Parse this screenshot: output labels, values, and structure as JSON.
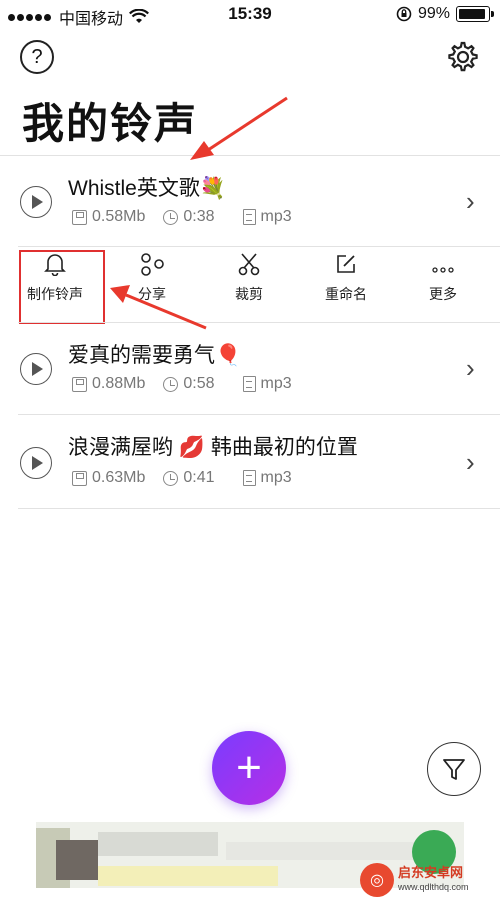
{
  "status_bar": {
    "carrier": "中国移动",
    "time": "15:39",
    "battery": "99%"
  },
  "page_title": "我的铃声",
  "songs": [
    {
      "title": "Whistle英文歌",
      "emoji": "💐",
      "size": "0.58Mb",
      "duration": "0:38",
      "format": "mp3"
    },
    {
      "title": "爱真的需要勇气",
      "emoji": "🎈",
      "size": "0.88Mb",
      "duration": "0:58",
      "format": "mp3"
    },
    {
      "title": "浪漫满屋哟 💋 韩曲最初的位置",
      "emoji": "",
      "size": "0.63Mb",
      "duration": "0:41",
      "format": "mp3"
    }
  ],
  "actions": [
    {
      "label": "制作铃声",
      "icon": "bell-icon"
    },
    {
      "label": "分享",
      "icon": "share-icon"
    },
    {
      "label": "裁剪",
      "icon": "scissors-icon"
    },
    {
      "label": "重命名",
      "icon": "edit-icon"
    },
    {
      "label": "更多",
      "icon": "more-icon"
    }
  ],
  "buttons": {
    "add": "+"
  },
  "watermark": {
    "name": "启东安卓网",
    "url": "www.qdlthdq.com"
  },
  "colors": {
    "accent_start": "#7a3cff",
    "accent_end": "#b62fe6",
    "highlight": "#e03030",
    "watermark": "#e8492f"
  }
}
